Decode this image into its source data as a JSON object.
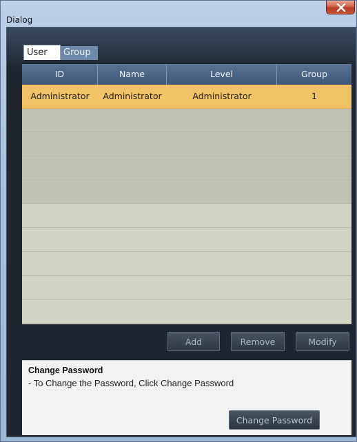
{
  "window": {
    "title": "Dialog"
  },
  "tabs": [
    {
      "label": "User",
      "active": true
    },
    {
      "label": "Group",
      "active": false
    }
  ],
  "table": {
    "columns": [
      "ID",
      "Name",
      "Level",
      "Group"
    ],
    "rows": [
      {
        "id": "Administrator",
        "name": "Administrator",
        "level": "Administrator",
        "group": "1",
        "selected": true
      }
    ]
  },
  "actions": {
    "add_label": "Add",
    "remove_label": "Remove",
    "modify_label": "Modify"
  },
  "change_password": {
    "title": "Change Password",
    "description": "- To Change the Password, Click Change Password",
    "button_label": "Change Password"
  },
  "colors": {
    "selected_row": "#f2c266",
    "header": "#4a6383",
    "panel_bg": "#1f2630"
  }
}
